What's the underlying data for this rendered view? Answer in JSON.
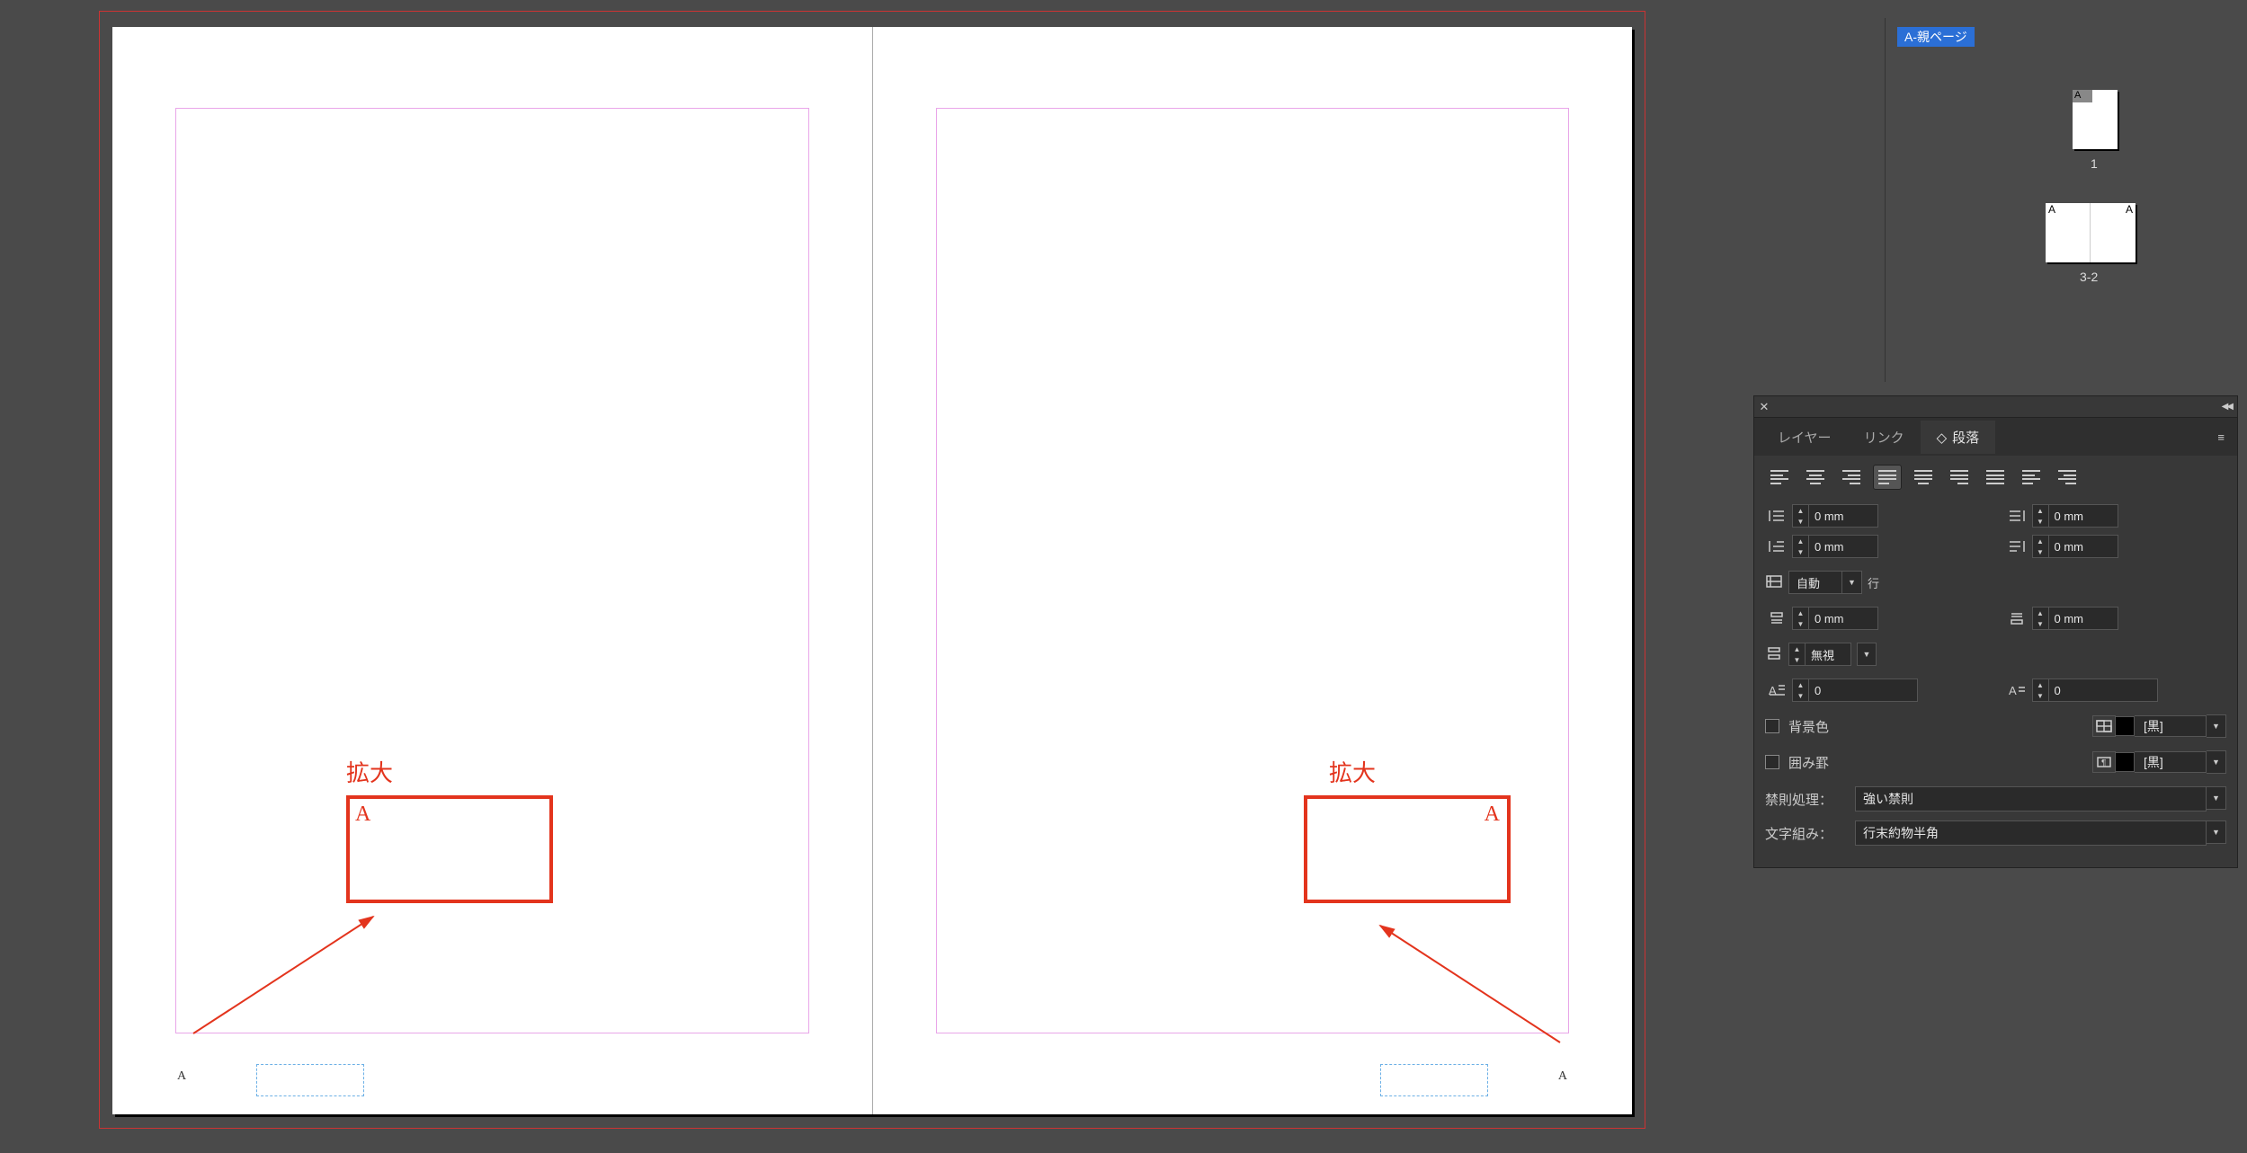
{
  "canvas": {
    "left_annot_label": "拡大",
    "right_annot_label": "拡大",
    "box_a": "A",
    "page_indicator": "A"
  },
  "pages_panel": {
    "master_label": "A-親ページ",
    "thumb1_label": "1",
    "thumb_spread_label": "3-2"
  },
  "para_panel": {
    "tabs": {
      "layers": "レイヤー",
      "links": "リンク",
      "paragraph": "段落"
    },
    "indents": {
      "left": "0 mm",
      "right": "0 mm",
      "first_left": "0 mm",
      "last_right": "0 mm"
    },
    "auto_row": {
      "value": "自動",
      "unit": "行"
    },
    "spacing": {
      "before": "0 mm",
      "after": "0 mm"
    },
    "ignore": "無視",
    "dropcaps": {
      "lines": "0",
      "chars": "0"
    },
    "bg_label": "背景色",
    "border_label": "囲み罫",
    "swatch_name": "[黒]",
    "kinsoku_label": "禁則処理：",
    "kinsoku_value": "強い禁則",
    "mojikumi_label": "文字組み：",
    "mojikumi_value": "行末約物半角"
  }
}
